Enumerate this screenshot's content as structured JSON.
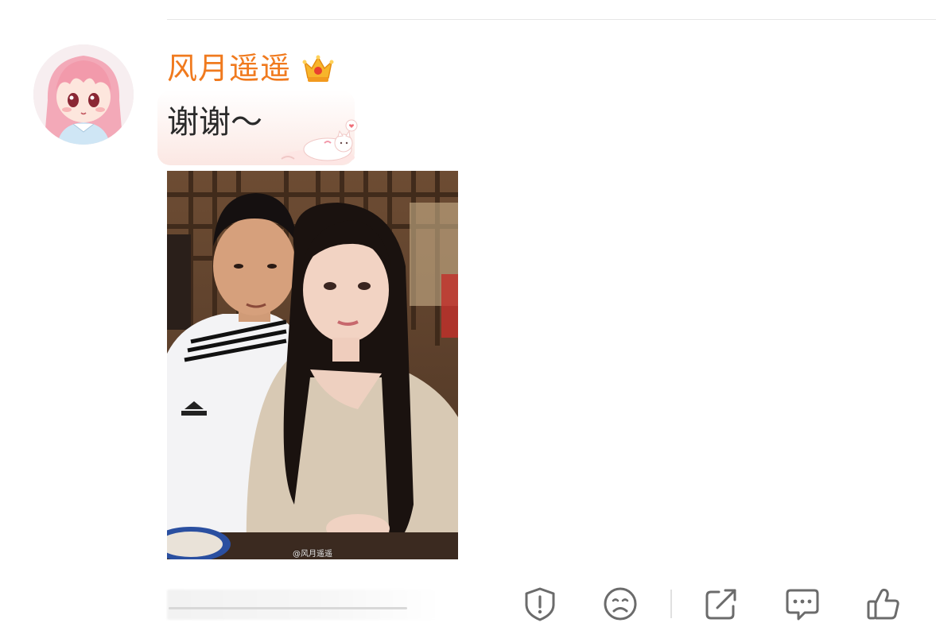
{
  "comment": {
    "username": "风月遥遥",
    "text": "谢谢～",
    "photo_watermark": "@风月遥遥"
  },
  "icons": {
    "avatar": "anime-girl-avatar",
    "badge": "crown-icon",
    "report": "shield-alert-icon",
    "dislike": "sad-face-icon",
    "share": "share-icon",
    "reply": "comment-icon",
    "like": "thumbs-up-icon"
  },
  "colors": {
    "username": "#f07a1e",
    "icon_stroke": "#6b6b6b",
    "bubble_tint": "#fbe7e3"
  }
}
